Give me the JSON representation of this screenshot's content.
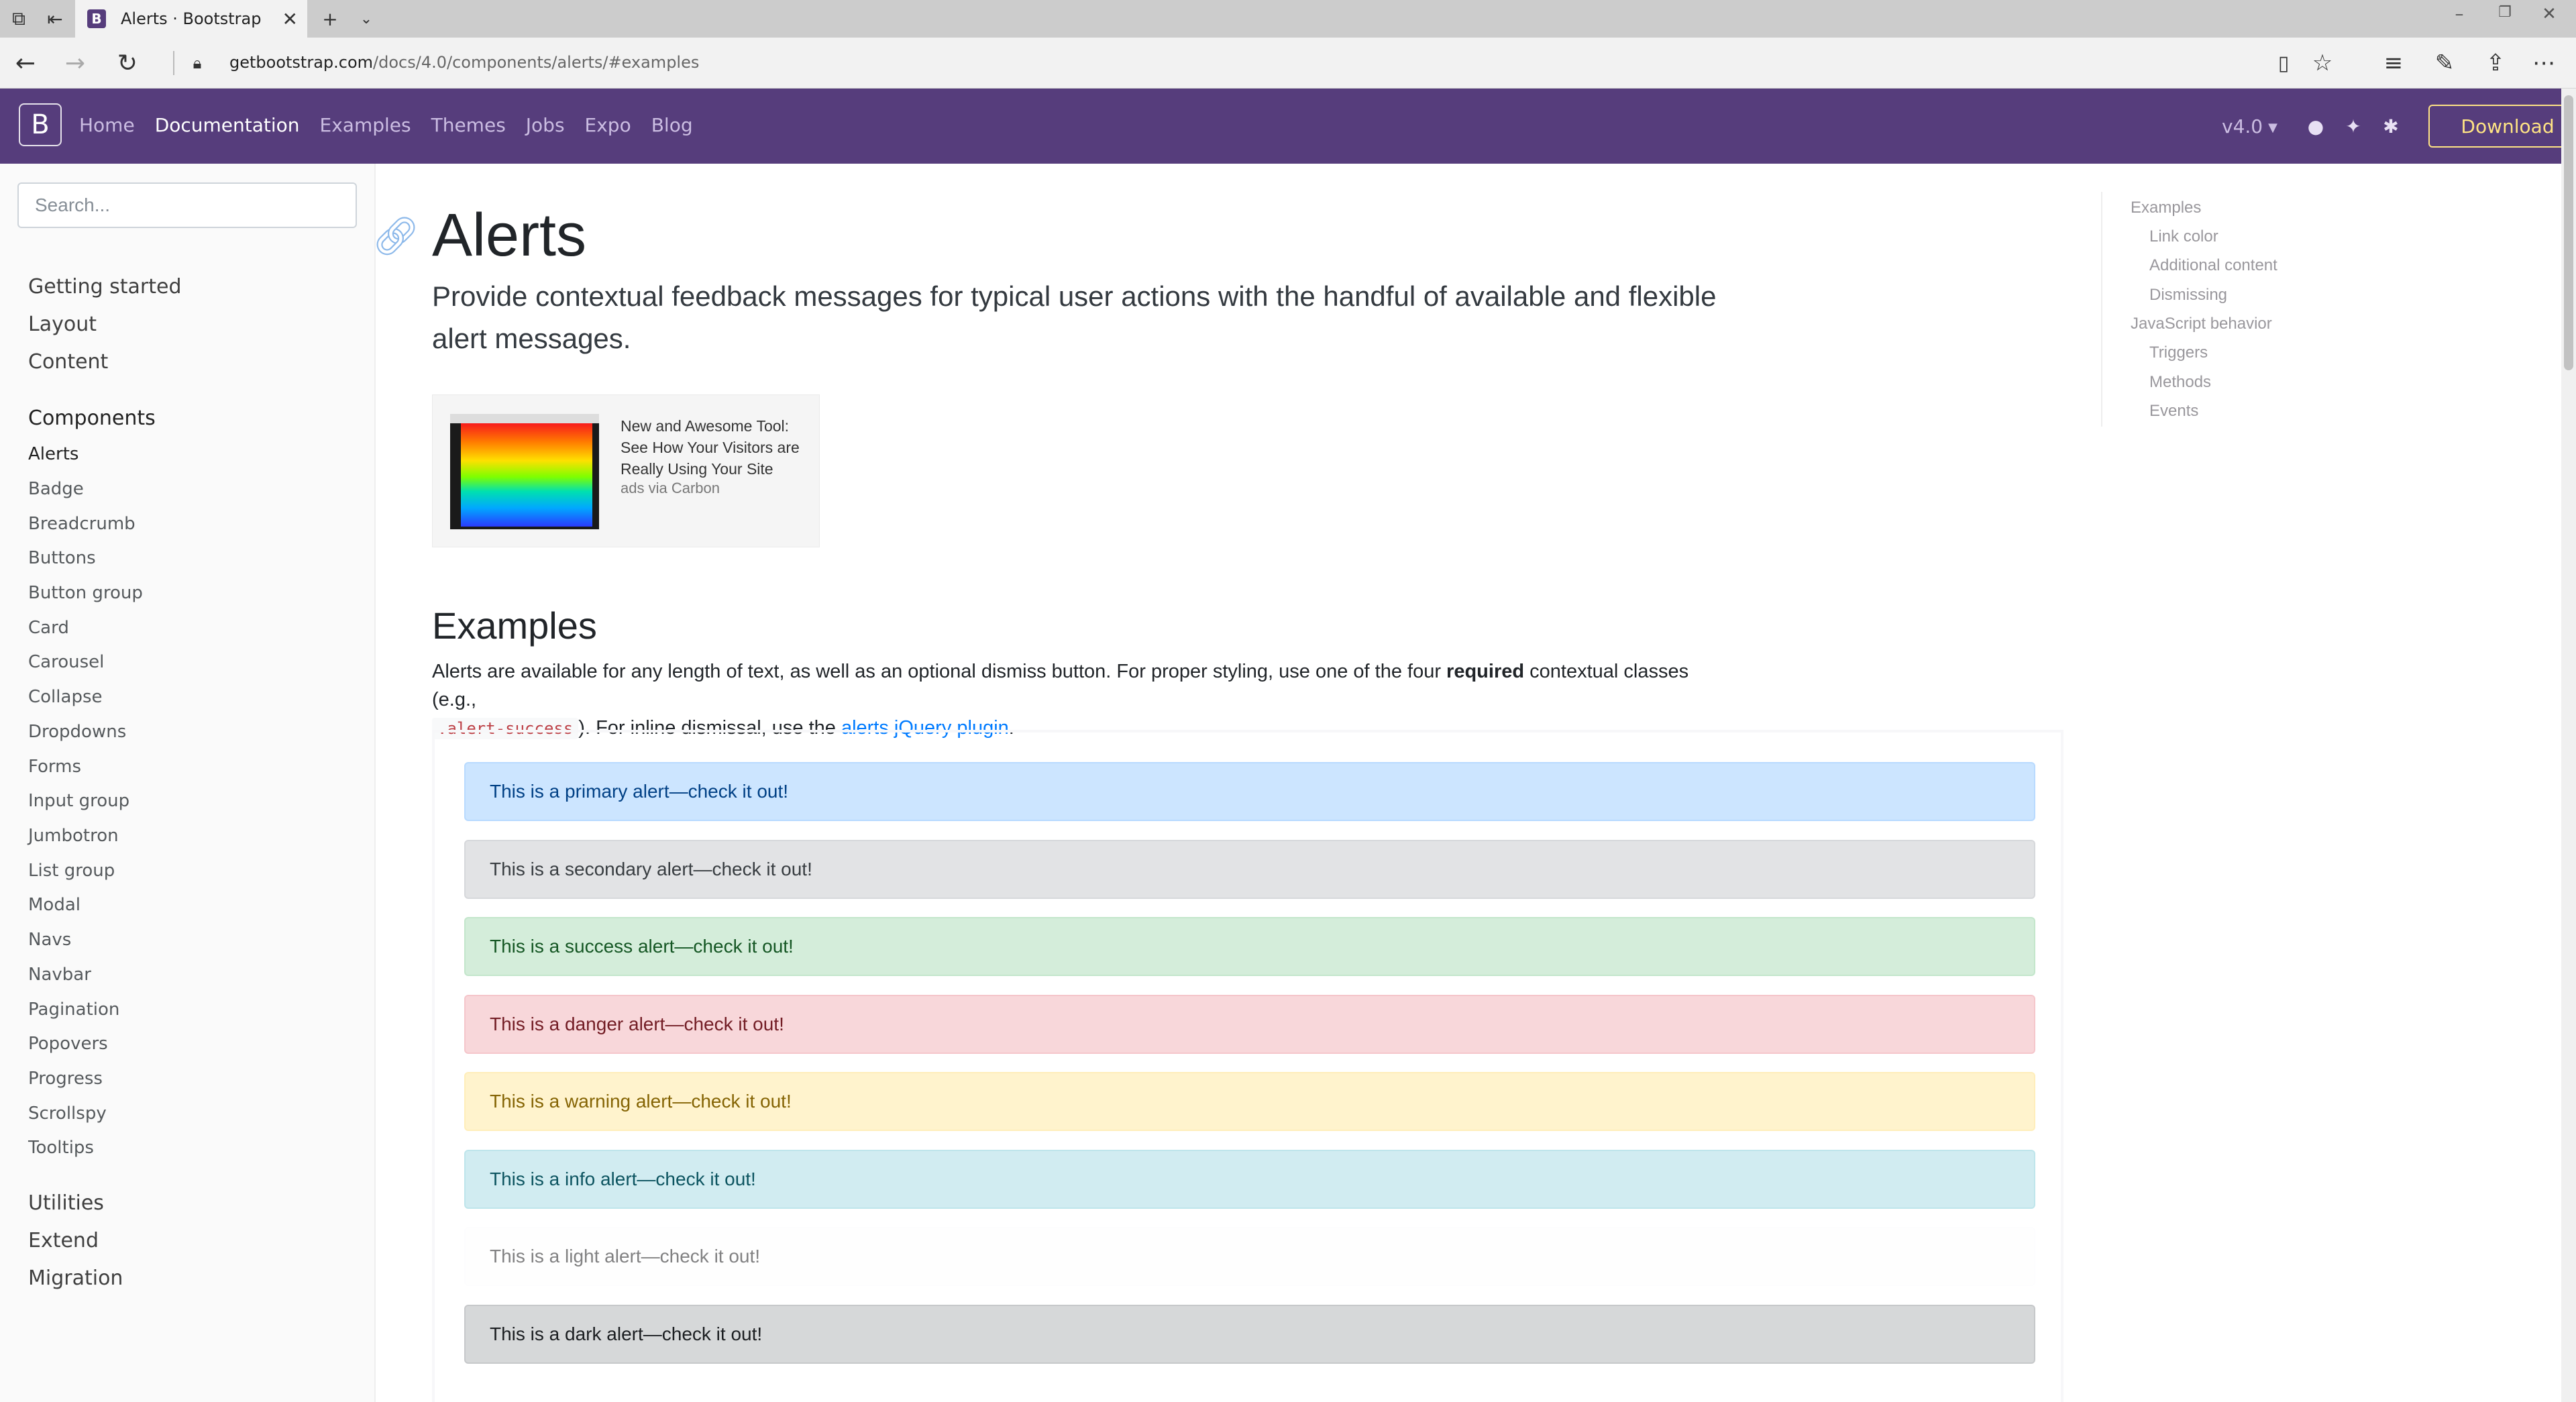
{
  "browser": {
    "tab_title": "Alerts · Bootstrap",
    "favicon_letter": "B",
    "url_host": "getbootstrap.com",
    "url_path": "/docs/4.0/components/alerts/#examples"
  },
  "navbar": {
    "brand": "B",
    "links": [
      "Home",
      "Documentation",
      "Examples",
      "Themes",
      "Jobs",
      "Expo",
      "Blog"
    ],
    "version": "v4.0",
    "download_label": "Download"
  },
  "sidebar": {
    "search_placeholder": "Search...",
    "sections_top": [
      "Getting started",
      "Layout",
      "Content"
    ],
    "components_heading": "Components",
    "components": [
      "Alerts",
      "Badge",
      "Breadcrumb",
      "Buttons",
      "Button group",
      "Card",
      "Carousel",
      "Collapse",
      "Dropdowns",
      "Forms",
      "Input group",
      "Jumbotron",
      "List group",
      "Modal",
      "Navs",
      "Navbar",
      "Pagination",
      "Popovers",
      "Progress",
      "Scrollspy",
      "Tooltips"
    ],
    "sections_bottom": [
      "Utilities",
      "Extend",
      "Migration"
    ]
  },
  "main": {
    "title": "Alerts",
    "lead": "Provide contextual feedback messages for typical user actions with the handful of available and flexible alert messages.",
    "ad": {
      "text": "New and Awesome Tool: See How Your Visitors are Really Using Your Site",
      "via": "ads via Carbon"
    },
    "examples_heading": "Examples",
    "examples_intro_1": "Alerts are available for any length of text, as well as an optional dismiss button. For proper styling, use one of the four ",
    "examples_intro_bold": "required",
    "examples_intro_2": " contextual classes (e.g.,",
    "examples_intro_code": ".alert-success",
    "examples_intro_3": "). For inline dismissal, use the ",
    "examples_intro_link": "alerts jQuery plugin",
    "examples_intro_4": ".",
    "alerts": [
      "This is a primary alert—check it out!",
      "This is a secondary alert—check it out!",
      "This is a success alert—check it out!",
      "This is a danger alert—check it out!",
      "This is a warning alert—check it out!",
      "This is a info alert—check it out!",
      "This is a light alert—check it out!",
      "This is a dark alert—check it out!"
    ]
  },
  "toc": {
    "items": [
      "Examples",
      "Link color",
      "Additional content",
      "Dismissing",
      "JavaScript behavior",
      "Triggers",
      "Methods",
      "Events"
    ]
  },
  "colors": {
    "brand_purple": "#563d7c",
    "download_yellow": "#ffe484",
    "link_blue": "#007bff"
  }
}
